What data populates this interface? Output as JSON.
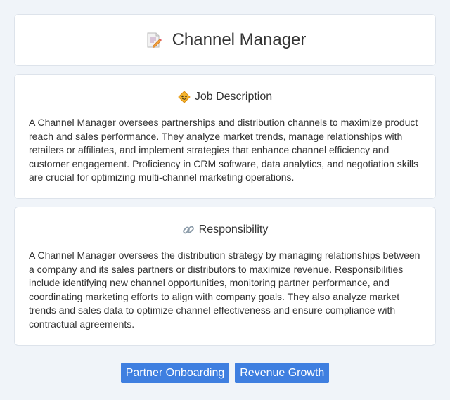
{
  "header": {
    "icon": "memo-icon",
    "title": "Channel Manager"
  },
  "job_description": {
    "icon": "diamond-icon",
    "heading": "Job Description",
    "text": "A Channel Manager oversees partnerships and distribution channels to maximize product reach and sales performance. They analyze market trends, manage relationships with retailers or affiliates, and implement strategies that enhance channel efficiency and customer engagement. Proficiency in CRM software, data analytics, and negotiation skills are crucial for optimizing multi-channel marketing operations."
  },
  "responsibility": {
    "icon": "link-icon",
    "heading": "Responsibility",
    "text": "A Channel Manager oversees the distribution strategy by managing relationships between a company and its sales partners or distributors to maximize revenue. Responsibilities include identifying new channel opportunities, monitoring partner performance, and coordinating marketing efforts to align with company goals. They also analyze market trends and sales data to optimize channel effectiveness and ensure compliance with contractual agreements."
  },
  "tags": [
    {
      "label": "Partner Onboarding"
    },
    {
      "label": "Revenue Growth"
    }
  ],
  "colors": {
    "background": "#f0f4f9",
    "card": "#ffffff",
    "tag": "#3f7fe0",
    "tag_text": "#ffffff"
  }
}
